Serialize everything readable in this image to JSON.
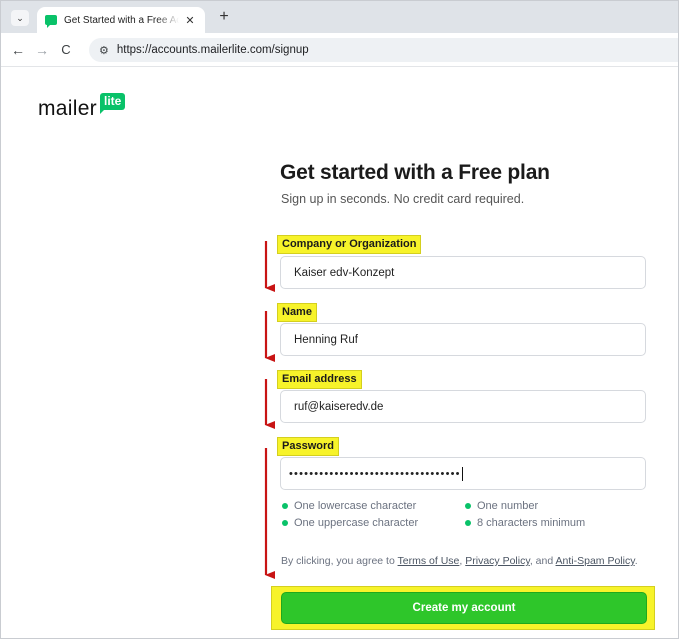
{
  "browser": {
    "tab_title": "Get Started with a Free Account",
    "tab_close": "✕",
    "new_tab": "+",
    "url": "https://accounts.mailerlite.com/signup"
  },
  "logo": {
    "word": "mailer",
    "badge": "lite"
  },
  "form": {
    "heading": "Get started with a Free plan",
    "subheading": "Sign up in seconds. No credit card required.",
    "company_label": "Company or Organization",
    "company_value": "Kaiser edv-Konzept",
    "name_label": "Name",
    "name_value": "Henning Ruf",
    "email_label": "Email address",
    "email_value": "ruf@kaiseredv.de",
    "password_label": "Password",
    "password_value": "••••••••••••••••••••••••••••••••••",
    "requirements": [
      "One lowercase character",
      "One number",
      "One uppercase character",
      "8 characters minimum"
    ],
    "terms_prefix": "By clicking, you agree to ",
    "terms_link": "Terms of Use",
    "terms_sep1": ", ",
    "privacy_link": "Privacy Policy",
    "terms_sep2": ", and ",
    "antispam_link": "Anti-Spam Policy",
    "terms_suffix": ".",
    "submit_label": "Create my account"
  },
  "colors": {
    "brand": "#09c269",
    "highlight": "#f7f32a",
    "cta": "#2ec62a",
    "arrow": "#c81414"
  }
}
